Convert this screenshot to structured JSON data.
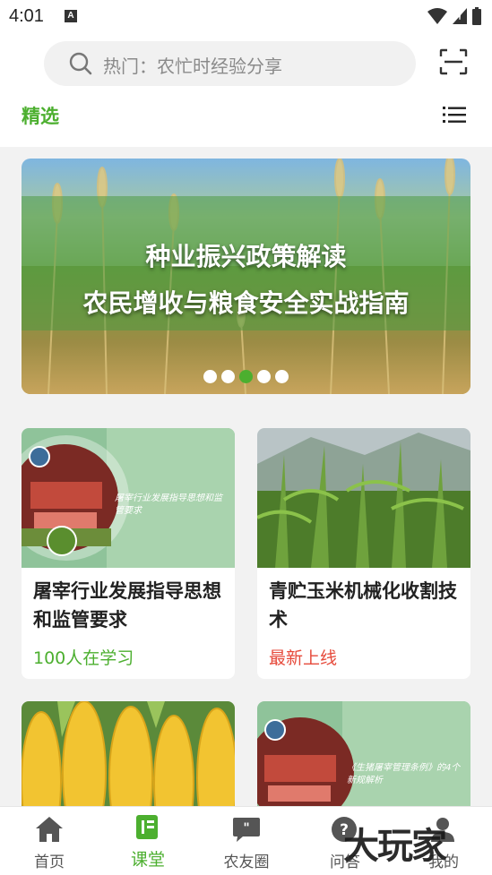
{
  "status": {
    "time": "4:01",
    "notice_glyph": "A"
  },
  "search": {
    "placeholder": "热门：农忙时经验分享"
  },
  "tabs": {
    "featured": "精选"
  },
  "banner": {
    "line1": "种业振兴政策解读",
    "line2": "农民增收与粮食安全实战指南",
    "active_dot": 2,
    "dot_count": 5
  },
  "cards": [
    {
      "title": "屠宰行业发展指导思想和监管要求",
      "meta": "100人在学习",
      "meta_color": "#4caf2f",
      "thumb_caption": "屠宰行业发展指导思想和监管要求"
    },
    {
      "title": "青贮玉米机械化收割技术",
      "meta": "最新上线",
      "meta_color": "#e64a3b"
    },
    {
      "title": "",
      "meta": ""
    },
    {
      "title": "",
      "meta": "",
      "thumb_caption": "《生猪屠宰管理条例》的4个新规解析"
    }
  ],
  "nav": [
    {
      "label": "首页",
      "icon": "home-icon"
    },
    {
      "label": "课堂",
      "icon": "classroom-icon",
      "active": true
    },
    {
      "label": "农友圈",
      "icon": "chat-icon"
    },
    {
      "label": "问答",
      "icon": "question-icon"
    },
    {
      "label": "我的",
      "icon": "profile-icon"
    }
  ],
  "watermark": "大玩家",
  "colors": {
    "accent": "#4caf2f",
    "new_tag": "#e64a3b"
  }
}
